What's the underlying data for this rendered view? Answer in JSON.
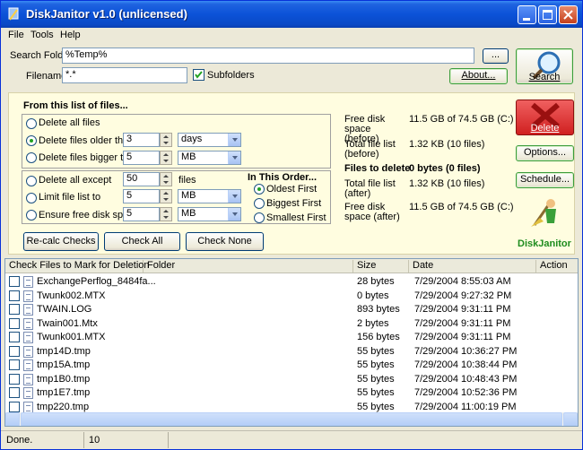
{
  "window": {
    "title": "DiskJanitor v1.0 (unlicensed)"
  },
  "menu": [
    "File",
    "Tools",
    "Help"
  ],
  "search": {
    "folder_label": "Search Folder",
    "folder_value": "%Temp%",
    "browse_label": "...",
    "filename_label": "Filename",
    "filename_value": "*.*",
    "subfolders_label": "Subfolders",
    "subfolders_checked": true,
    "about_label": "About...",
    "search_label": "Search"
  },
  "filters": {
    "heading": "From this list of files...",
    "delete_all": "Delete all files",
    "older_than": "Delete files older than",
    "older_value": "3",
    "older_unit": "days",
    "bigger_than": "Delete files bigger than",
    "bigger_value": "5",
    "bigger_unit": "MB",
    "all_except": "Delete all except",
    "except_value": "50",
    "except_unit": "files",
    "limit_list": "Limit file list to",
    "limit_value": "5",
    "limit_unit": "MB",
    "ensure_free": "Ensure free disk space",
    "ensure_value": "5",
    "ensure_unit": "MB"
  },
  "order": {
    "heading": "In This Order...",
    "oldest": "Oldest First",
    "biggest": "Biggest First",
    "smallest": "Smallest First"
  },
  "actions": {
    "recalc": "Re-calc Checks",
    "check_all": "Check All",
    "check_none": "Check None"
  },
  "stats": {
    "free_before_label": "Free disk space (before)",
    "free_before_value": "11.5 GB of 74.5 GB (C:)",
    "total_before_label": "Total file list (before)",
    "total_before_value": "1.32 KB (10 files)",
    "to_delete_label": "Files to delete",
    "to_delete_value": "0 bytes (0 files)",
    "total_after_label": "Total file list (after)",
    "total_after_value": "1.32 KB (10 files)",
    "free_after_label": "Free disk space (after)",
    "free_after_value": "11.5 GB of 74.5 GB (C:)"
  },
  "side": {
    "delete": "Delete",
    "options": "Options...",
    "schedule": "Schedule...",
    "brand": "DiskJanitor"
  },
  "list": {
    "headers": [
      "Check Files to Mark for Deletion",
      "Folder",
      "Size",
      "Date",
      "Action"
    ],
    "rows": [
      {
        "name": "ExchangePerflog_8484fa...",
        "size": "28 bytes",
        "date": "7/29/2004 8:55:03 AM"
      },
      {
        "name": "Twunk002.MTX",
        "size": "0 bytes",
        "date": "7/29/2004 9:27:32 PM"
      },
      {
        "name": "TWAIN.LOG",
        "size": "893 bytes",
        "date": "7/29/2004 9:31:11 PM"
      },
      {
        "name": "Twain001.Mtx",
        "size": "2 bytes",
        "date": "7/29/2004 9:31:11 PM"
      },
      {
        "name": "Twunk001.MTX",
        "size": "156 bytes",
        "date": "7/29/2004 9:31:11 PM"
      },
      {
        "name": "tmp14D.tmp",
        "size": "55 bytes",
        "date": "7/29/2004 10:36:27 PM"
      },
      {
        "name": "tmp15A.tmp",
        "size": "55 bytes",
        "date": "7/29/2004 10:38:44 PM"
      },
      {
        "name": "tmp1B0.tmp",
        "size": "55 bytes",
        "date": "7/29/2004 10:48:43 PM"
      },
      {
        "name": "tmp1E7.tmp",
        "size": "55 bytes",
        "date": "7/29/2004 10:52:36 PM"
      },
      {
        "name": "tmp220.tmp",
        "size": "55 bytes",
        "date": "7/29/2004 11:00:19 PM"
      }
    ]
  },
  "status": {
    "text": "Done.",
    "count": "10"
  },
  "colors": {
    "titlebar": "#0b52d8",
    "panel": "#fffde0",
    "delete_red": "#e83030",
    "brand_green": "#1e8c1e"
  }
}
